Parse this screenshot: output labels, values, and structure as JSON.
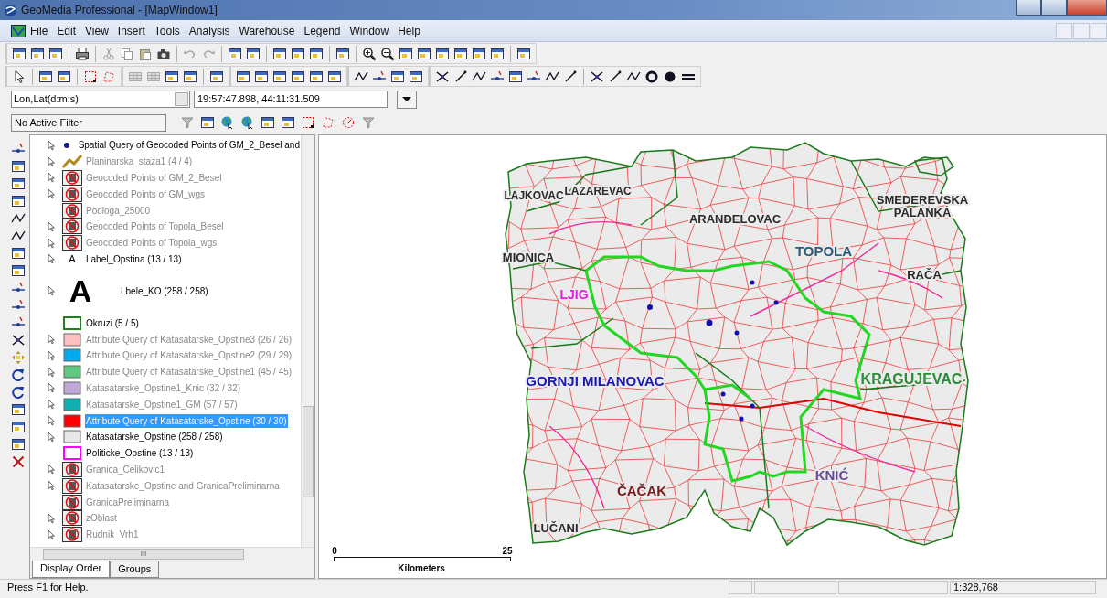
{
  "window": {
    "title": "GeoMedia Professional - [MapWindow1]"
  },
  "menu": [
    {
      "label": "File"
    },
    {
      "label": "Edit"
    },
    {
      "label": "View"
    },
    {
      "label": "Insert"
    },
    {
      "label": "Tools"
    },
    {
      "label": "Analysis"
    },
    {
      "label": "Warehouse"
    },
    {
      "label": "Legend"
    },
    {
      "label": "Window"
    },
    {
      "label": "Help"
    }
  ],
  "coordinates": {
    "system": "Lon,Lat(d:m:s)",
    "value": "19:57:47.898, 44:11:31.509"
  },
  "filter": {
    "value": "No Active Filter"
  },
  "legend": {
    "entries": [
      {
        "label": "Spatial Query of Geocoded Points of GM_2_Besel and",
        "kind": "point",
        "color": "#1a1a8a",
        "locatable": true,
        "dimmed": false,
        "selected": false
      },
      {
        "label": "Planinarska_staza1 (4 / 4)",
        "kind": "line",
        "color": "#b08a20",
        "locatable": true,
        "dimmed": true,
        "selected": false
      },
      {
        "label": "Geocoded Points of GM_2_Besel",
        "kind": "unavailable",
        "locatable": true,
        "dimmed": true,
        "selected": false
      },
      {
        "label": "Geocoded Points of GM_wgs",
        "kind": "unavailable",
        "locatable": true,
        "dimmed": true,
        "selected": false
      },
      {
        "label": "Podloga_25000",
        "kind": "unavailable",
        "locatable": false,
        "dimmed": true,
        "selected": false
      },
      {
        "label": "Geocoded Points of Topola_Besel",
        "kind": "unavailable",
        "locatable": true,
        "dimmed": true,
        "selected": false
      },
      {
        "label": "Geocoded Points of Topola_wgs",
        "kind": "unavailable",
        "locatable": true,
        "dimmed": true,
        "selected": false
      },
      {
        "label": "Label_Opstina (13 / 13)",
        "kind": "label_small",
        "symbol_text": "A",
        "locatable": true,
        "dimmed": false,
        "selected": false
      },
      {
        "label": "Lbele_KO (258 / 258)",
        "kind": "label_large",
        "symbol_text": "A",
        "locatable": true,
        "dimmed": false,
        "selected": false
      },
      {
        "label": "Okruzi (5 / 5)",
        "kind": "outline",
        "color": "#208020",
        "locatable": false,
        "dimmed": false,
        "selected": false
      },
      {
        "label": "Attribute Query of Katasatarske_Opstine3 (26 / 26)",
        "kind": "area",
        "color": "#ffc0c0",
        "locatable": true,
        "dimmed": true,
        "selected": false
      },
      {
        "label": "Attribute Query of Katasatarske_Opstine2 (29 / 29)",
        "kind": "area",
        "color": "#00aaee",
        "locatable": true,
        "dimmed": true,
        "selected": false
      },
      {
        "label": "Attribute Query of Katasatarske_Opstine1 (45 / 45)",
        "kind": "area",
        "color": "#60c880",
        "locatable": true,
        "dimmed": true,
        "selected": false
      },
      {
        "label": "Katasatarske_Opstine1_Knic (32 / 32)",
        "kind": "area",
        "color": "#c0a8d8",
        "locatable": true,
        "dimmed": true,
        "selected": false
      },
      {
        "label": "Katasatarske_Opstine1_GM (57 / 57)",
        "kind": "area",
        "color": "#10b0b0",
        "locatable": true,
        "dimmed": true,
        "selected": false
      },
      {
        "label": "Attribute Query of Katasatarske_Opstine (30 / 30)",
        "kind": "area",
        "color": "#ff0000",
        "locatable": true,
        "dimmed": true,
        "selected": true
      },
      {
        "label": "Katasatarske_Opstine (258 / 258)",
        "kind": "area",
        "color": "#e8e8e8",
        "locatable": true,
        "dimmed": false,
        "selected": false
      },
      {
        "label": "Politicke_Opstine (13 / 13)",
        "kind": "outline",
        "color": "#ff00ff",
        "locatable": false,
        "dimmed": false,
        "selected": false
      },
      {
        "label": "Granica_Celikovic1",
        "kind": "unavailable",
        "locatable": true,
        "dimmed": true,
        "selected": false
      },
      {
        "label": "Katasatarske_Opstine and GranicaPreliminarna",
        "kind": "unavailable",
        "locatable": true,
        "dimmed": true,
        "selected": false
      },
      {
        "label": "GranicaPreliminarna",
        "kind": "unavailable",
        "locatable": false,
        "dimmed": true,
        "selected": false
      },
      {
        "label": "zOblast",
        "kind": "unavailable",
        "locatable": true,
        "dimmed": true,
        "selected": false
      },
      {
        "label": "Rudnik_Vrh1",
        "kind": "unavailable",
        "locatable": true,
        "dimmed": true,
        "selected": false
      }
    ]
  },
  "legend_scroll_mark": "III",
  "tabs": [
    {
      "label": "Display Order",
      "selected": true
    },
    {
      "label": "Groups",
      "selected": false
    }
  ],
  "map": {
    "labels": [
      {
        "text": "LAJKOVAC",
        "color": "#2a2a2a"
      },
      {
        "text": "LAZAREVAC",
        "color": "#2a2a2a"
      },
      {
        "text": "ARANĐELOVAC",
        "color": "#2a2a2a"
      },
      {
        "text": "TOPOLA",
        "color": "#2a5c7a"
      },
      {
        "text": "SMEDEREVSKA PALANKA",
        "color": "#2a2a2a"
      },
      {
        "text": "MIONICA",
        "color": "#2a2a2a"
      },
      {
        "text": "RAČA",
        "color": "#2a2a2a"
      },
      {
        "text": "LJIG",
        "color": "#e020e0"
      },
      {
        "text": "GORNJI MILANOVAC",
        "color": "#1a1ab0"
      },
      {
        "text": "KRAGUJEVAC",
        "color": "#2e8b3a"
      },
      {
        "text": "ČAČAK",
        "color": "#7a1a1a"
      },
      {
        "text": "KNIĆ",
        "color": "#6a4a9a"
      },
      {
        "text": "LUČANI",
        "color": "#2a2a2a"
      }
    ],
    "scale_bar": {
      "start": "0",
      "end": "25",
      "unit": "Kilometers"
    }
  },
  "status_bar": {
    "help": "Press F1 for Help.",
    "scale": "1:328,768"
  }
}
